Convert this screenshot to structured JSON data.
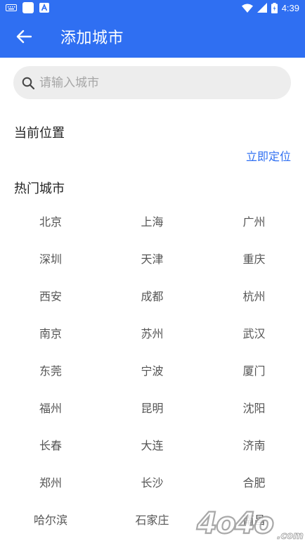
{
  "status_bar": {
    "time": "4:39",
    "left_icons": [
      "keyboard-icon",
      "square-app-icon",
      "a-app-icon"
    ],
    "right_icons": [
      "wifi-icon",
      "signal-icon",
      "battery-icon"
    ]
  },
  "app_bar": {
    "title": "添加城市",
    "back_icon": "arrow-left-icon",
    "color": "#2f6ff2"
  },
  "search": {
    "placeholder": "请输入城市",
    "value": "",
    "icon": "search-icon"
  },
  "current_location": {
    "title": "当前位置",
    "locate_label": "立即定位"
  },
  "hot_cities": {
    "title": "热门城市",
    "cities": [
      "北京",
      "上海",
      "广州",
      "深圳",
      "天津",
      "重庆",
      "西安",
      "成都",
      "杭州",
      "南京",
      "苏州",
      "武汉",
      "东莞",
      "宁波",
      "厦门",
      "福州",
      "昆明",
      "沈阳",
      "长春",
      "大连",
      "济南",
      "郑州",
      "长沙",
      "合肥",
      "哈尔滨",
      "石家庄",
      "南昌"
    ]
  },
  "watermark": {
    "text": "4o4o.com"
  }
}
